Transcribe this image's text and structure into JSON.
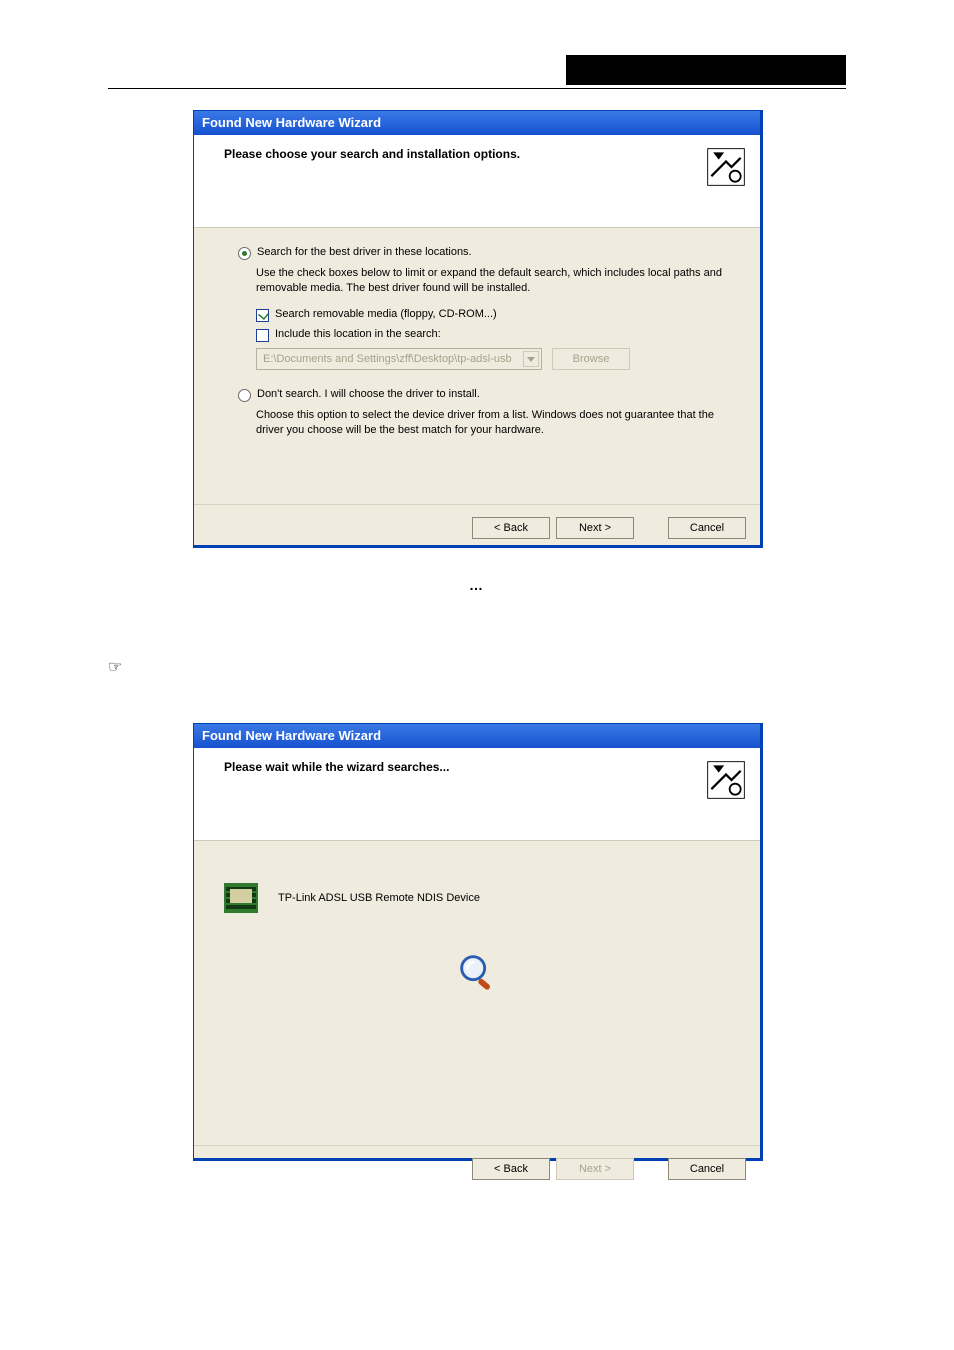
{
  "doc": {
    "ellipsis": "…",
    "pointer_glyph": "☞"
  },
  "wizard1": {
    "title": "Found New Hardware Wizard",
    "heading": "Please choose your search and installation options.",
    "radio_search_label": "Search for the best driver in these locations.",
    "radio_search_help": "Use the check boxes below to limit or expand the default search, which includes local paths and removable media. The best driver found will be installed.",
    "chk_removable_label": "Search removable media (floppy, CD-ROM...)",
    "chk_include_label": "Include this location in the search:",
    "path_value": "E:\\Documents and Settings\\zff\\Desktop\\tp-adsl-usb",
    "browse_label": "Browse",
    "radio_manual_label": "Don't search. I will choose the driver to install.",
    "radio_manual_help": "Choose this option to select the device driver from a list.  Windows does not guarantee that the driver you choose will be the best match for your hardware.",
    "back_label": "< Back",
    "next_label": "Next >",
    "cancel_label": "Cancel"
  },
  "wizard2": {
    "title": "Found New Hardware Wizard",
    "heading": "Please wait while the wizard searches...",
    "device_name": "TP-Link ADSL USB Remote NDIS Device",
    "back_label": "< Back",
    "next_label": "Next >",
    "cancel_label": "Cancel"
  }
}
